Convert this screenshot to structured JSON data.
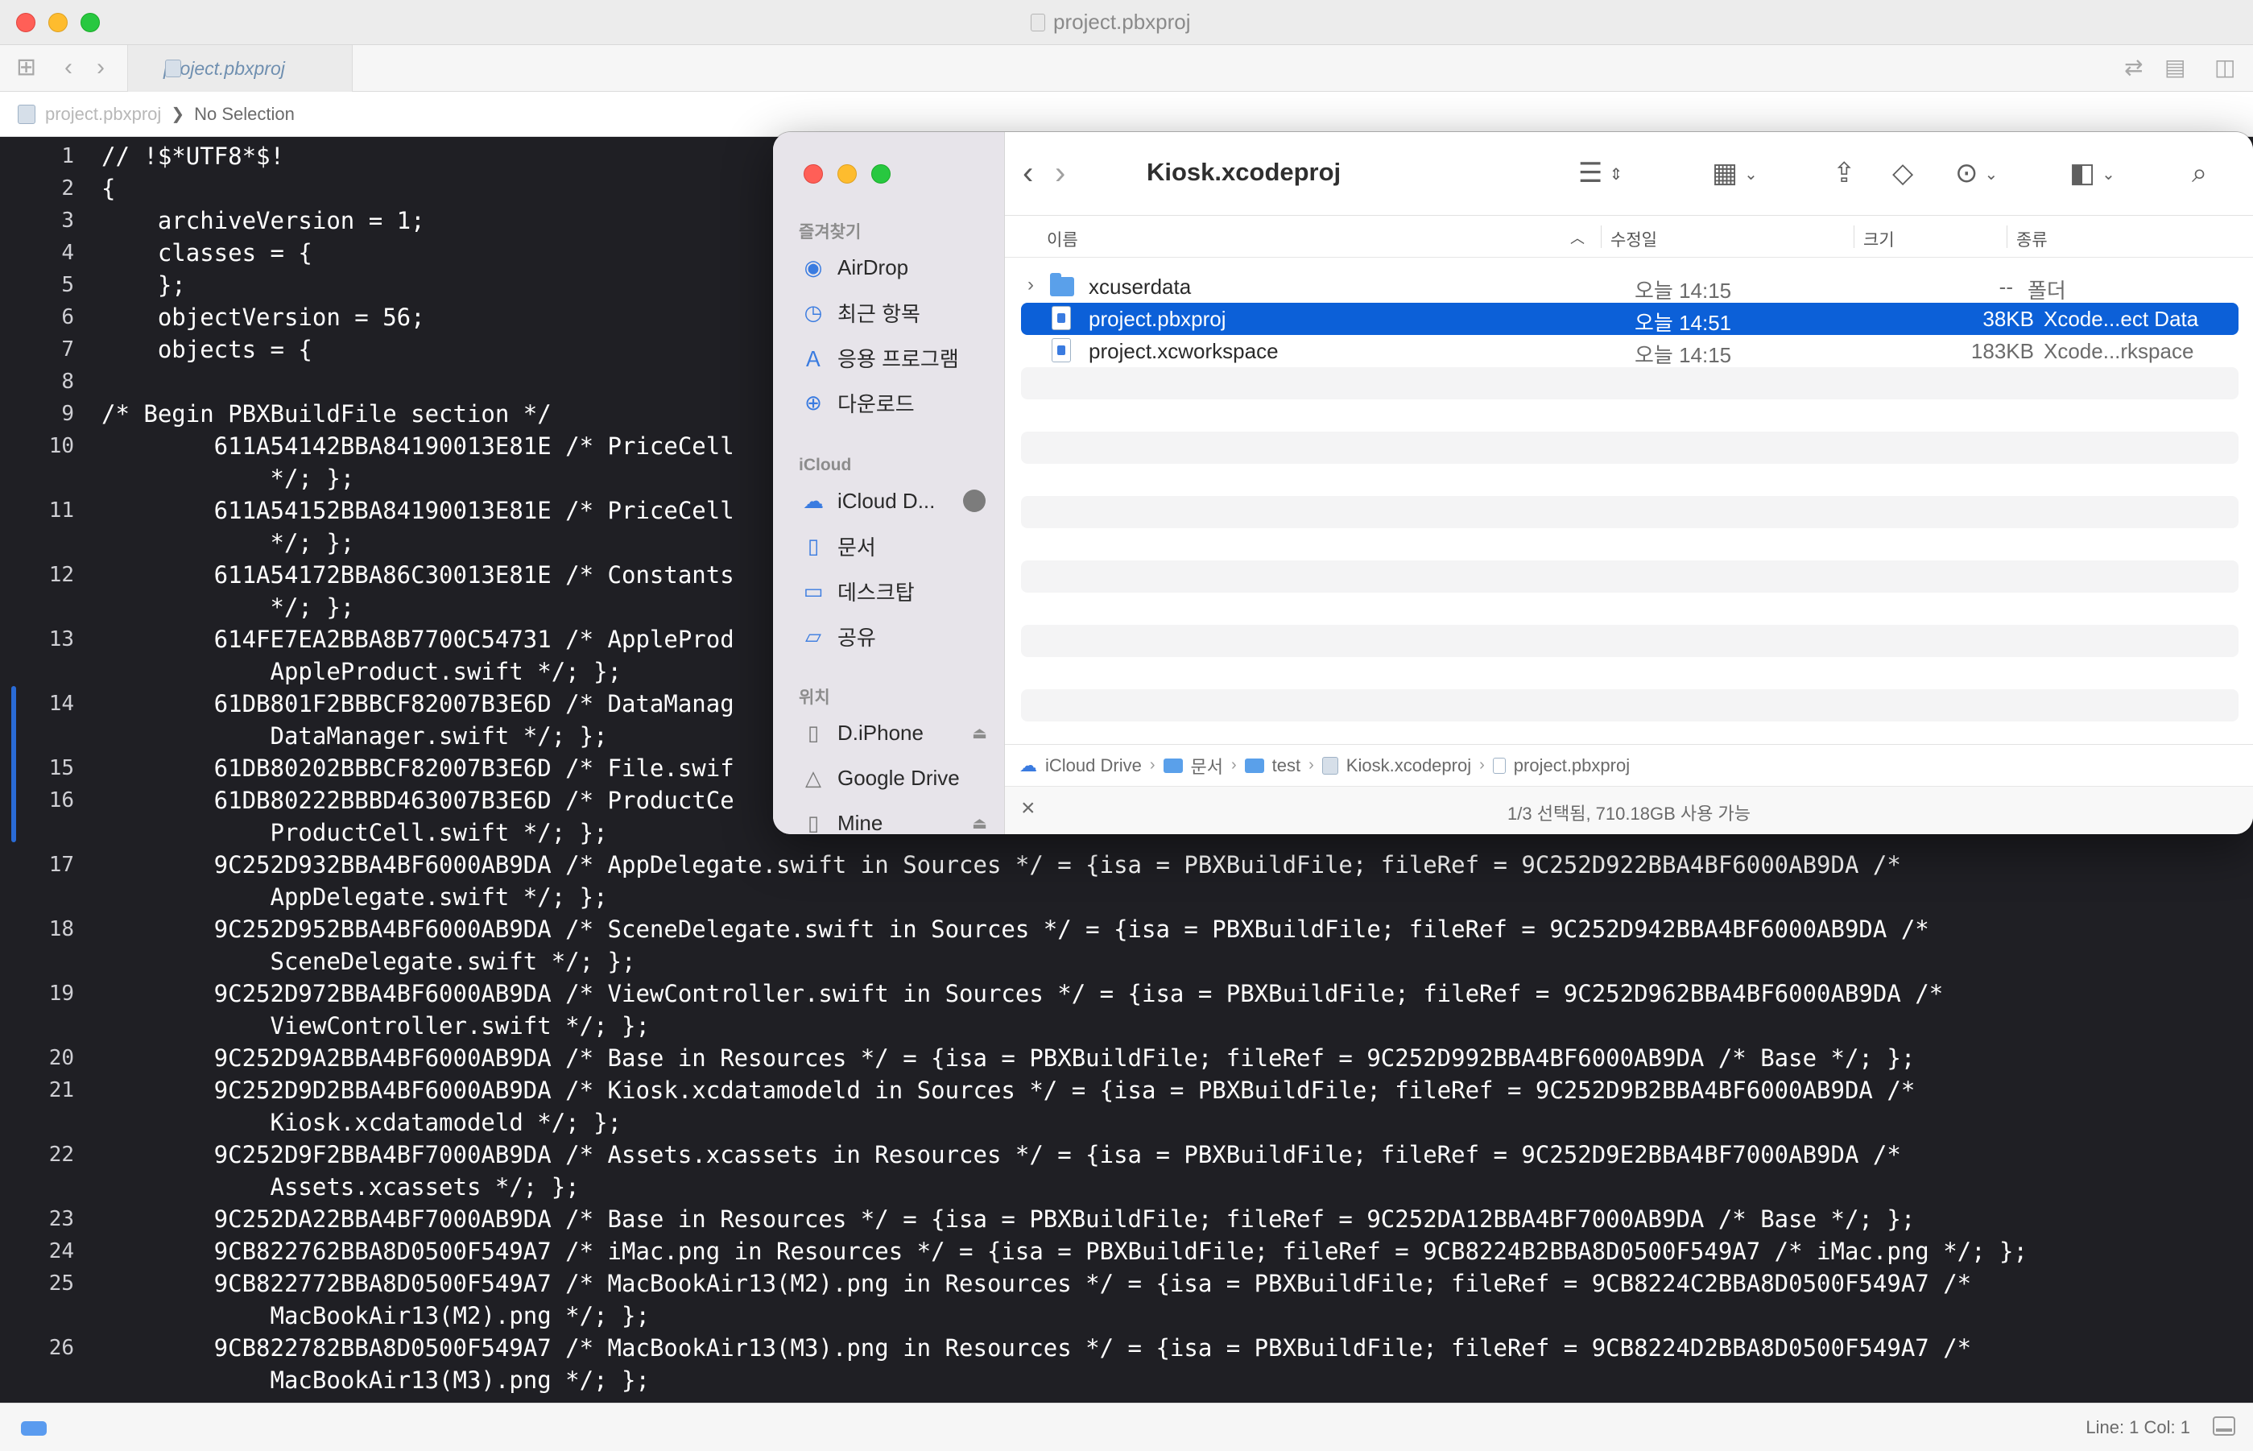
{
  "xcode": {
    "window_title": "project.pbxproj",
    "tab_label": "project.pbxproj",
    "breadcrumb": {
      "file": "project.pbxproj",
      "selection": "No Selection"
    },
    "lines": [
      {
        "n": "1",
        "text": "// !$*UTF8*$!"
      },
      {
        "n": "2",
        "text": "{"
      },
      {
        "n": "3",
        "text": "    archiveVersion = 1;"
      },
      {
        "n": "4",
        "text": "    classes = {"
      },
      {
        "n": "5",
        "text": "    };"
      },
      {
        "n": "6",
        "text": "    objectVersion = 56;"
      },
      {
        "n": "7",
        "text": "    objects = {"
      },
      {
        "n": "8",
        "text": ""
      },
      {
        "n": "9",
        "text": "/* Begin PBXBuildFile section */"
      },
      {
        "n": "10",
        "text": "        611A54142BBA84190013E81E /* PriceCell"
      },
      {
        "n": "",
        "text": "            */; };"
      },
      {
        "n": "11",
        "text": "        611A54152BBA84190013E81E /* PriceCell"
      },
      {
        "n": "",
        "text": "            */; };"
      },
      {
        "n": "12",
        "text": "        611A54172BBA86C30013E81E /* Constants"
      },
      {
        "n": "",
        "text": "            */; };"
      },
      {
        "n": "13",
        "text": "        614FE7EA2BBA8B7700C54731 /* AppleProd"
      },
      {
        "n": "",
        "text": "            AppleProduct.swift */; };"
      },
      {
        "n": "14",
        "text": "        61DB801F2BBBCF82007B3E6D /* DataManag"
      },
      {
        "n": "",
        "text": "            DataManager.swift */; };"
      },
      {
        "n": "15",
        "text": "        61DB80202BBBCF82007B3E6D /* File.swif"
      },
      {
        "n": "16",
        "text": "        61DB80222BBBD463007B3E6D /* ProductCe"
      },
      {
        "n": "",
        "text": "            ProductCell.swift */; };"
      },
      {
        "n": "17",
        "text": "        9C252D932BBA4BF6000AB9DA /* AppDelegate.swift in Sources */ = {isa = PBXBuildFile; fileRef = 9C252D922BBA4BF6000AB9DA /*"
      },
      {
        "n": "",
        "text": "            AppDelegate.swift */; };"
      },
      {
        "n": "18",
        "text": "        9C252D952BBA4BF6000AB9DA /* SceneDelegate.swift in Sources */ = {isa = PBXBuildFile; fileRef = 9C252D942BBA4BF6000AB9DA /*"
      },
      {
        "n": "",
        "text": "            SceneDelegate.swift */; };"
      },
      {
        "n": "19",
        "text": "        9C252D972BBA4BF6000AB9DA /* ViewController.swift in Sources */ = {isa = PBXBuildFile; fileRef = 9C252D962BBA4BF6000AB9DA /*"
      },
      {
        "n": "",
        "text": "            ViewController.swift */; };"
      },
      {
        "n": "20",
        "text": "        9C252D9A2BBA4BF6000AB9DA /* Base in Resources */ = {isa = PBXBuildFile; fileRef = 9C252D992BBA4BF6000AB9DA /* Base */; };"
      },
      {
        "n": "21",
        "text": "        9C252D9D2BBA4BF6000AB9DA /* Kiosk.xcdatamodeld in Sources */ = {isa = PBXBuildFile; fileRef = 9C252D9B2BBA4BF6000AB9DA /*"
      },
      {
        "n": "",
        "text": "            Kiosk.xcdatamodeld */; };"
      },
      {
        "n": "22",
        "text": "        9C252D9F2BBA4BF7000AB9DA /* Assets.xcassets in Resources */ = {isa = PBXBuildFile; fileRef = 9C252D9E2BBA4BF7000AB9DA /*"
      },
      {
        "n": "",
        "text": "            Assets.xcassets */; };"
      },
      {
        "n": "23",
        "text": "        9C252DA22BBA4BF7000AB9DA /* Base in Resources */ = {isa = PBXBuildFile; fileRef = 9C252DA12BBA4BF7000AB9DA /* Base */; };"
      },
      {
        "n": "24",
        "text": "        9CB822762BBA8D0500F549A7 /* iMac.png in Resources */ = {isa = PBXBuildFile; fileRef = 9CB8224B2BBA8D0500F549A7 /* iMac.png */; };"
      },
      {
        "n": "25",
        "text": "        9CB822772BBA8D0500F549A7 /* MacBookAir13(M2).png in Resources */ = {isa = PBXBuildFile; fileRef = 9CB8224C2BBA8D0500F549A7 /*"
      },
      {
        "n": "",
        "text": "            MacBookAir13(M2).png */; };"
      },
      {
        "n": "26",
        "text": "        9CB822782BBA8D0500F549A7 /* MacBookAir13(M3).png in Resources */ = {isa = PBXBuildFile; fileRef = 9CB8224D2BBA8D0500F549A7 /*"
      },
      {
        "n": "",
        "text": "            MacBookAir13(M3).png */; };"
      }
    ],
    "status": {
      "position": "Line: 1  Col: 1"
    }
  },
  "finder": {
    "title": "Kiosk.xcodeproj",
    "sidebar": {
      "favorites_header": "즐겨찾기",
      "favorites": [
        {
          "label": "AirDrop",
          "icon": "airdrop-icon",
          "glyph": "◉"
        },
        {
          "label": "최근 항목",
          "icon": "clock-icon",
          "glyph": "◷"
        },
        {
          "label": "응용 프로그램",
          "icon": "apps-icon",
          "glyph": "Ａ"
        },
        {
          "label": "다운로드",
          "icon": "download-icon",
          "glyph": "⊕"
        }
      ],
      "icloud_header": "iCloud",
      "icloud": [
        {
          "label": "iCloud D...",
          "icon": "cloud-icon",
          "glyph": "☁"
        },
        {
          "label": "문서",
          "icon": "document-icon",
          "glyph": "▯"
        },
        {
          "label": "데스크탑",
          "icon": "desktop-icon",
          "glyph": "▭"
        },
        {
          "label": "공유",
          "icon": "shared-folder-icon",
          "glyph": "▱"
        }
      ],
      "locations_header": "위치",
      "locations": [
        {
          "label": "D.iPhone",
          "icon": "iphone-icon",
          "glyph": "▯"
        },
        {
          "label": "Google Drive",
          "icon": "google-drive-icon",
          "glyph": "△"
        },
        {
          "label": "Mine",
          "icon": "disk-icon",
          "glyph": "▯"
        }
      ]
    },
    "columns": {
      "name": "이름",
      "date": "수정일",
      "size": "크기",
      "kind": "종류"
    },
    "rows": [
      {
        "name": "xcuserdata",
        "date": "오늘 14:15",
        "size": "--",
        "kind": "폴더"
      },
      {
        "name": "project.pbxproj",
        "date": "오늘 14:51",
        "size": "38KB",
        "kind": "Xcode...ect Data"
      },
      {
        "name": "project.xcworkspace",
        "date": "오늘 14:15",
        "size": "183KB",
        "kind": "Xcode...rkspace"
      }
    ],
    "path": [
      "iCloud Drive",
      "문서",
      "test",
      "Kiosk.xcodeproj",
      "project.pbxproj"
    ],
    "status": "1/3 선택됨, 710.18GB 사용 가능"
  }
}
